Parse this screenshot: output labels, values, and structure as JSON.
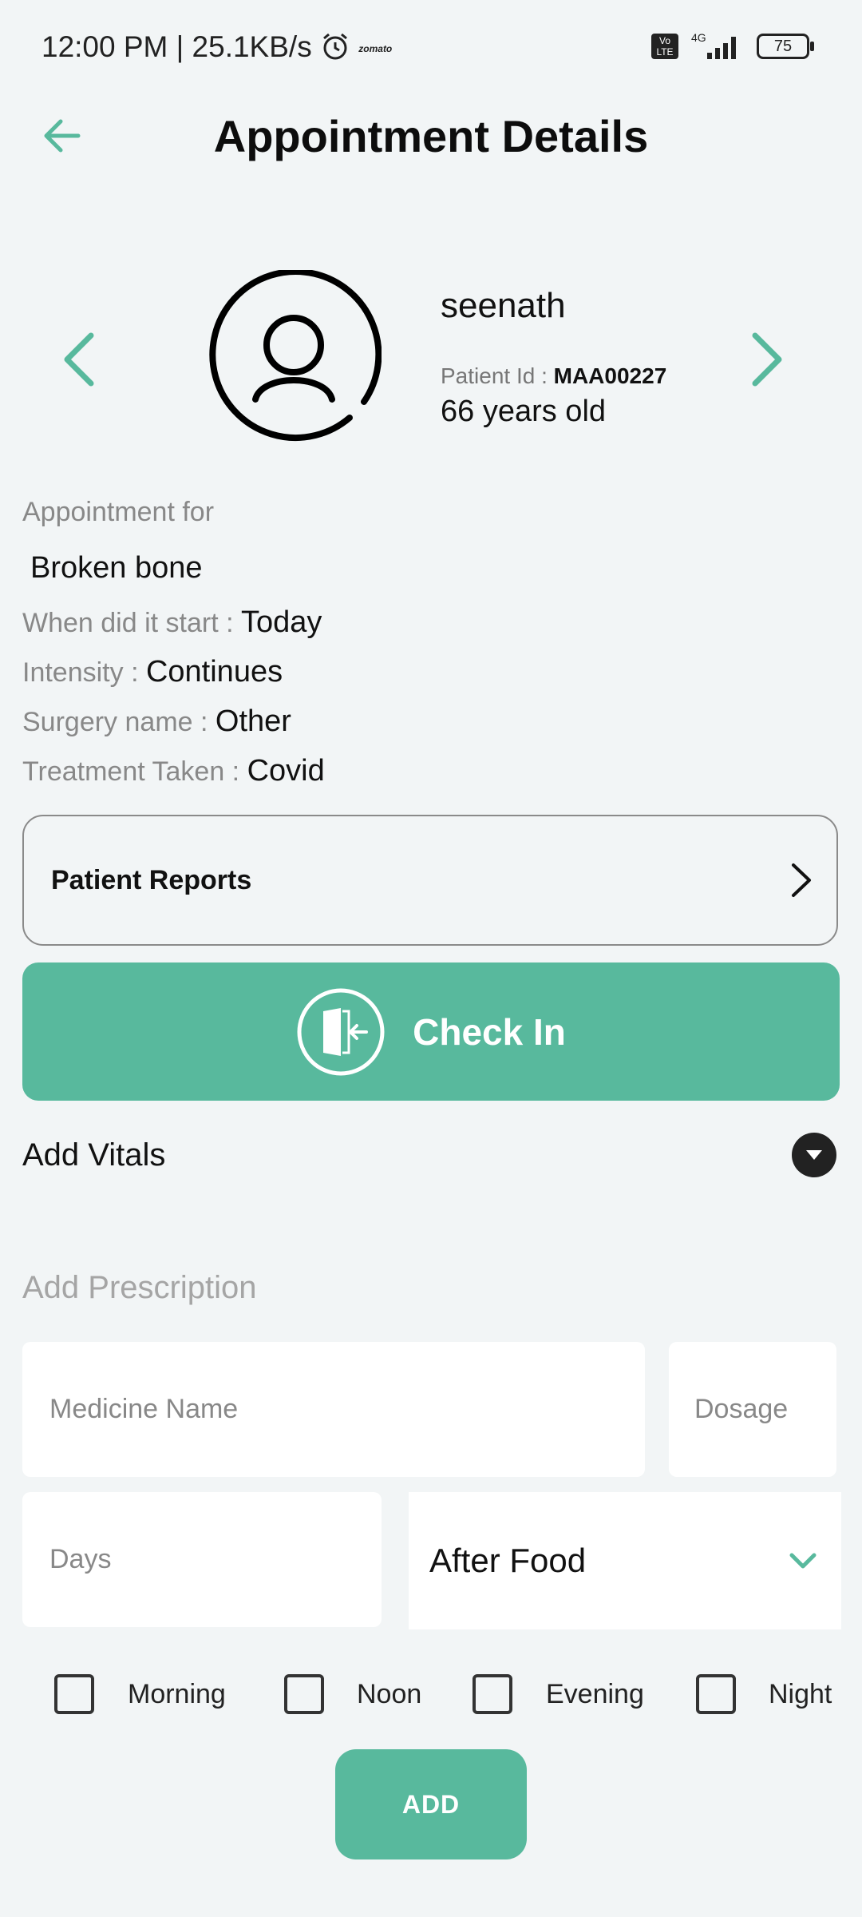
{
  "status_bar": {
    "time_speed": "12:00 PM | 25.1KB/s",
    "app_mark": "zomato",
    "network": "4G",
    "volte": "Vo LTE",
    "battery": "75"
  },
  "header": {
    "title": "Appointment Details",
    "back_icon": "arrow-left-icon"
  },
  "patient": {
    "name": "seenath",
    "id_label": "Patient Id : ",
    "id_value": "MAA00227",
    "age": "66 years old"
  },
  "appointment": {
    "for_label": "Appointment for",
    "reason": "Broken bone",
    "details": [
      {
        "label": "When did it start : ",
        "value": "Today"
      },
      {
        "label": "Intensity : ",
        "value": "Continues"
      },
      {
        "label": "Surgery name : ",
        "value": "Other"
      },
      {
        "label": "Treatment Taken : ",
        "value": "Covid"
      }
    ]
  },
  "reports": {
    "label": "Patient Reports"
  },
  "checkin": {
    "label": "Check In"
  },
  "vitals": {
    "label": "Add Vitals"
  },
  "prescription": {
    "title": "Add Prescription",
    "medicine_placeholder": "Medicine Name",
    "dosage_placeholder": "Dosage",
    "days_placeholder": "Days",
    "food_selected": "After Food",
    "times": [
      "Morning",
      "Noon",
      "Evening",
      "Night"
    ],
    "add_label": "ADD"
  },
  "colors": {
    "accent": "#58b99d",
    "background": "#f2f5f6"
  }
}
